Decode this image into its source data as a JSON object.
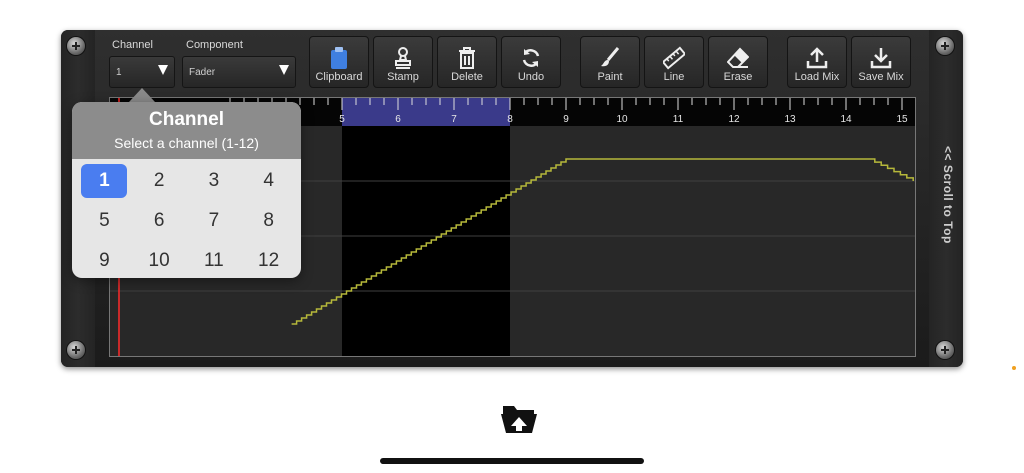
{
  "header": {
    "channel_label": "Channel",
    "component_label": "Component",
    "channel_value": "1",
    "component_value": "Fader"
  },
  "toolbar": {
    "clipboard": "Clipboard",
    "stamp": "Stamp",
    "delete": "Delete",
    "undo": "Undo",
    "paint": "Paint",
    "line": "Line",
    "erase": "Erase",
    "load_mix": "Load Mix",
    "save_mix": "Save Mix"
  },
  "side": {
    "scroll_to_top": "<< Scroll to Top"
  },
  "timeline": {
    "ticks": [
      "5",
      "6",
      "7",
      "8",
      "9",
      "10",
      "11",
      "12",
      "13",
      "14",
      "15"
    ]
  },
  "popup": {
    "title": "Channel",
    "subtitle": "Select a channel (1-12)",
    "options": [
      "1",
      "2",
      "3",
      "4",
      "5",
      "6",
      "7",
      "8",
      "9",
      "10",
      "11",
      "12"
    ],
    "selected": "1"
  },
  "chart_data": {
    "type": "line",
    "x_ticks": [
      5,
      6,
      7,
      8,
      9,
      10,
      11,
      12,
      13,
      14,
      15
    ],
    "series": [
      {
        "values": [
          [
            4.1,
            0.1
          ],
          [
            9.0,
            0.85
          ],
          [
            14.4,
            0.85
          ],
          [
            15.2,
            0.75
          ]
        ]
      }
    ],
    "selection": [
      6.0,
      8.0
    ],
    "colors": {
      "line": "#b6b83a",
      "selection": "#3a3a8a",
      "playhead": "#ff2a2a"
    }
  }
}
